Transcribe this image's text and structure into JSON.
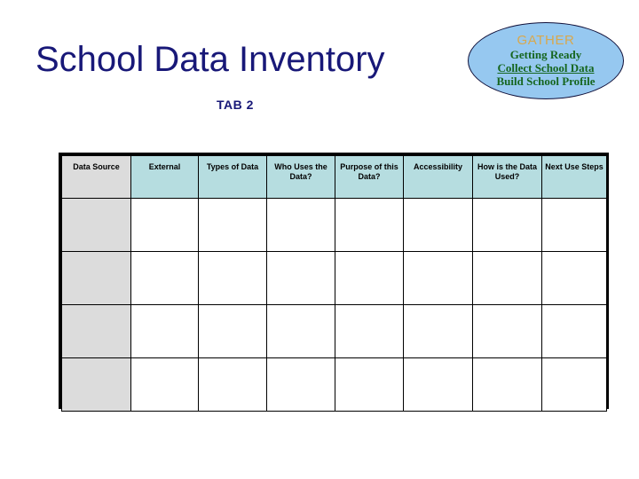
{
  "slide": {
    "title": "School Data Inventory",
    "subtitle": "TAB 2"
  },
  "badge": {
    "name": "gather-oval",
    "heading": "GATHER",
    "lines": [
      {
        "text": "Getting Ready",
        "underlined": false
      },
      {
        "text": "Collect School Data",
        "underlined": true
      },
      {
        "text": "Build School Profile",
        "underlined": false
      }
    ],
    "fill_color": "#96c8f0",
    "border_color": "#10103a",
    "heading_color": "#d8a84e",
    "line_color": "#16661f"
  },
  "table": {
    "headers": [
      "Data Source",
      "External",
      "Types of Data",
      "Who Uses the Data?",
      "Purpose of this Data?",
      "Accessibility",
      "How is the Data Used?",
      "Next Use Steps"
    ],
    "header_fill": "#b6dde0",
    "first_column_fill": "#dcdcdc",
    "row_count": 4,
    "column_count": 8,
    "rows": [
      [
        "",
        "",
        "",
        "",
        "",
        "",
        "",
        ""
      ],
      [
        "",
        "",
        "",
        "",
        "",
        "",
        "",
        ""
      ],
      [
        "",
        "",
        "",
        "",
        "",
        "",
        "",
        ""
      ],
      [
        "",
        "",
        "",
        "",
        "",
        "",
        "",
        ""
      ]
    ]
  },
  "theme": {
    "title_color": "#181878",
    "background": "#ffffff",
    "border_color": "#000000"
  }
}
